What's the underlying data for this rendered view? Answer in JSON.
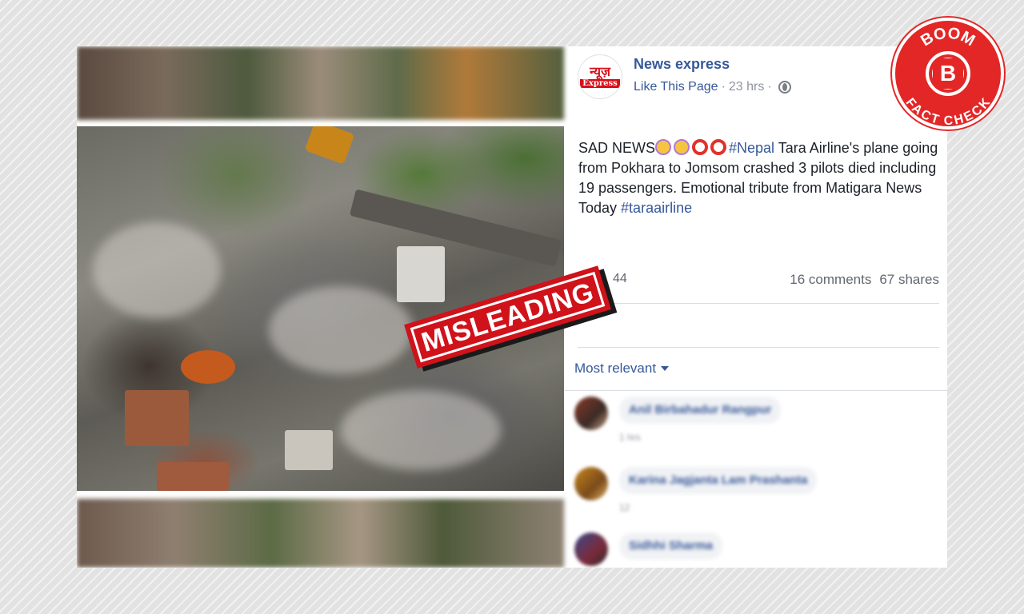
{
  "post": {
    "page_name": "News express",
    "like_page_label": "Like This Page",
    "separator": "·",
    "time_ago": "23 hrs",
    "avatar_line1": "न्यूज़",
    "avatar_line2": "Express",
    "text_prefix": "SAD NEWS",
    "hashtag_nepal": "#Nepal",
    "text_body": " Tara Airline's plane going from Pokhara to Jomsom crashed 3 pilots died including 19 passengers. Emotional tribute from Matigara News Today ",
    "hashtag_airline": "#taraairline",
    "reaction_count": "44",
    "comments_count": "16 comments",
    "shares_count": "67 shares",
    "sort_label": "Most relevant"
  },
  "stamp": {
    "label": "MISLEADING"
  },
  "badge": {
    "top": "BOOM",
    "bottom": "FACT CHECK",
    "center": "B"
  },
  "comments": [
    {
      "name": "Anil Birbahadur Rangpur",
      "meta": "1 hrs"
    },
    {
      "name": "Karina Jagjanta Lam Prashanta",
      "meta": "12"
    },
    {
      "name": "Sidhhi Sharma",
      "meta": ""
    }
  ],
  "icons": [
    "globe-icon",
    "sad-reaction-icon",
    "like-reaction-icon",
    "caret-down-icon"
  ],
  "colors": {
    "link": "#365899",
    "stamp_red": "#d0121b",
    "badge_red": "#e32726"
  }
}
